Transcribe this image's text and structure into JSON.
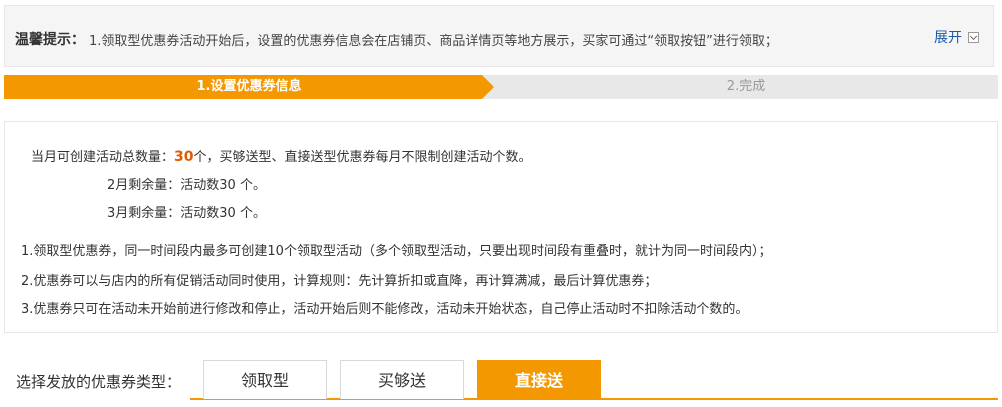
{
  "notice": {
    "label": "温馨提示：",
    "text": "1.领取型优惠券活动开始后，设置的优惠券信息会在店铺页、商品详情页等地方展示，买家可通过“领取按钮”进行领取；",
    "expand_label": "展开"
  },
  "steps": [
    {
      "label": "1.设置优惠券信息",
      "active": true
    },
    {
      "label": "2.完成",
      "active": false
    }
  ],
  "info": {
    "quota_prefix": "当月可创建活动总数量：",
    "quota_count": "30",
    "quota_suffix": "个，买够送型、直接送型优惠券每月不限制创建活动个数。",
    "remaining": [
      {
        "month": "2月剩余量：",
        "text": "活动数30 个。"
      },
      {
        "month": "3月剩余量：",
        "text": "活动数30 个。"
      }
    ],
    "rules": [
      "1.领取型优惠券，同一时间段内最多可创建10个领取型活动（多个领取型活动，只要出现时间段有重叠时，就计为同一时间段内）；",
      "2.优惠券可以与店内的所有促销活动同时使用，计算规则：先计算折扣或直降，再计算满减，最后计算优惠券；",
      "3.优惠券只可在活动未开始前进行修改和停止，活动开始后则不能修改，活动未开始状态，自己停止活动时不扣除活动个数的。"
    ]
  },
  "coupon_type": {
    "label": "选择发放的优惠券类型：",
    "options": [
      "领取型",
      "买够送",
      "直接送"
    ],
    "selected": "直接送"
  },
  "colors": {
    "accent": "#f39800",
    "highlight": "#e05a00",
    "link": "#1a5aa8"
  }
}
